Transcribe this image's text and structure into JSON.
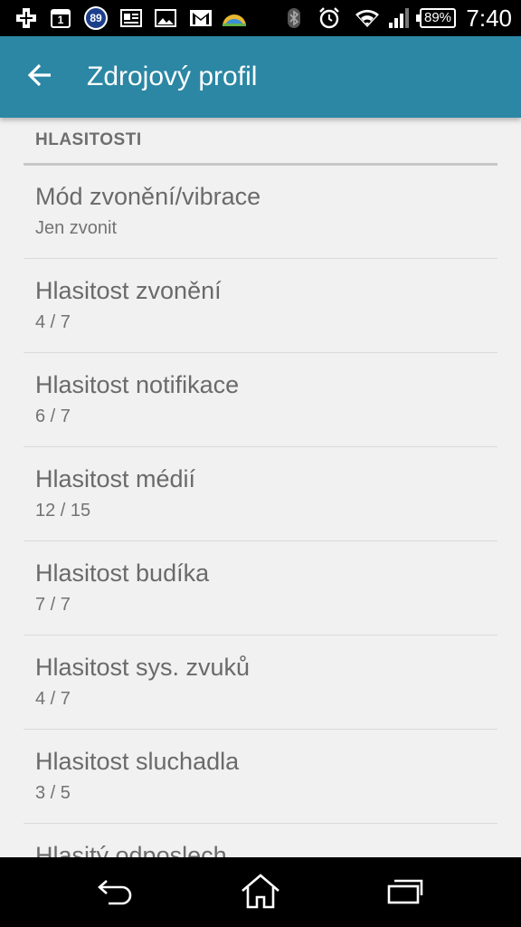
{
  "status_bar": {
    "time": "7:40",
    "battery": "89%",
    "badge_number": "89",
    "calendar_day": "1",
    "icons": [
      "add-box-icon",
      "calendar-icon",
      "badge-89-icon",
      "news-icon",
      "image-icon",
      "gmail-icon",
      "weather-icon",
      "bluetooth-icon",
      "alarm-icon",
      "wifi-icon",
      "signal-icon",
      "battery-icon"
    ]
  },
  "app_bar": {
    "title": "Zdrojový profil",
    "back_icon": "arrow-left-icon",
    "color": "#2b87a4"
  },
  "section": {
    "header": "HLASITOSTI"
  },
  "items": [
    {
      "title": "Mód zvonění/vibrace",
      "summary": "Jen zvonit"
    },
    {
      "title": "Hlasitost zvonění",
      "summary": "4 / 7"
    },
    {
      "title": "Hlasitost notifikace",
      "summary": "6 / 7"
    },
    {
      "title": "Hlasitost médií",
      "summary": "12 / 15"
    },
    {
      "title": "Hlasitost budíka",
      "summary": "7 / 7"
    },
    {
      "title": "Hlasitost sys. zvuků",
      "summary": "4 / 7"
    },
    {
      "title": "Hlasitost sluchadla",
      "summary": "3 / 5"
    },
    {
      "title": "Hlasitý odposlech",
      "summary": ""
    }
  ],
  "nav_bar": {
    "icons": [
      "back-icon",
      "home-icon",
      "recent-apps-icon"
    ]
  }
}
